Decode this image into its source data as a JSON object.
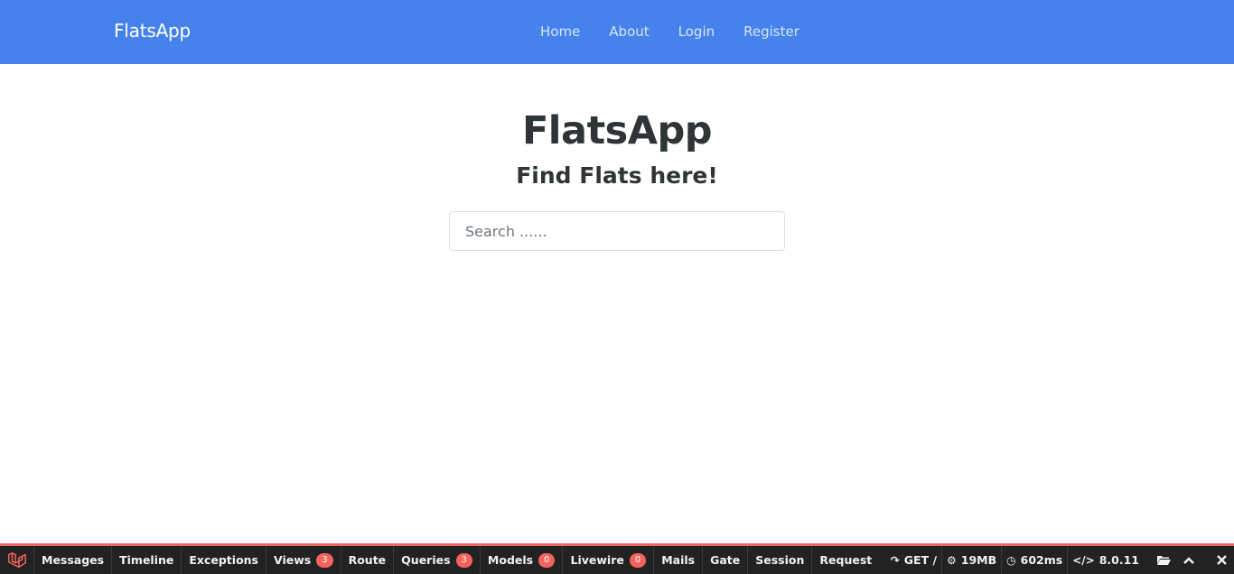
{
  "navbar": {
    "brand": "FlatsApp",
    "links": [
      {
        "label": "Home"
      },
      {
        "label": "About"
      },
      {
        "label": "Login"
      },
      {
        "label": "Register"
      }
    ]
  },
  "hero": {
    "title": "FlatsApp",
    "subtitle": "Find Flats here!",
    "search_placeholder": "Search ......"
  },
  "debugbar": {
    "tabs": [
      {
        "label": "Messages"
      },
      {
        "label": "Timeline"
      },
      {
        "label": "Exceptions"
      },
      {
        "label": "Views",
        "badge": "3"
      },
      {
        "label": "Route"
      },
      {
        "label": "Queries",
        "badge": "3"
      },
      {
        "label": "Models",
        "badge": "0"
      },
      {
        "label": "Livewire",
        "badge": "0"
      },
      {
        "label": "Mails"
      },
      {
        "label": "Gate"
      },
      {
        "label": "Session"
      },
      {
        "label": "Request"
      }
    ],
    "request": "GET /",
    "memory": "19MB",
    "time": "602ms",
    "php_version": "8.0.11",
    "icons": {
      "logo": "laravel-logo-icon",
      "request": "share-arrow-icon",
      "memory": "cogs-icon",
      "time": "clock-icon",
      "php": "code-icon",
      "open": "folder-open-icon",
      "restore": "chevron-up-icon",
      "close": "close-icon"
    },
    "colors": {
      "accent": "#f4645f",
      "background": "#222222"
    }
  },
  "colors": {
    "navbar": "#4582ec",
    "text": "#2f3437"
  }
}
